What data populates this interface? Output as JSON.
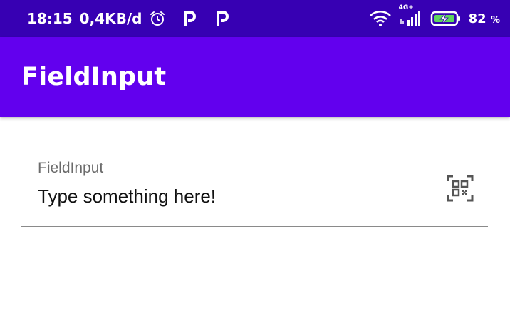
{
  "status_bar": {
    "time": "18:15",
    "network_speed": "0,4KB/d",
    "signal_type": "4G+",
    "battery_percent": "82",
    "battery_unit": "%",
    "icons": [
      "alarm-icon",
      "parking-app-icon",
      "parking-app-icon",
      "wifi-icon",
      "cell-signal-icon",
      "battery-charging-icon"
    ]
  },
  "app_bar": {
    "title": "FieldInput",
    "color": "#6200ee",
    "status_color": "#3700b3"
  },
  "field": {
    "label": "FieldInput",
    "value": "",
    "placeholder": "Type something here!",
    "trailing_icon": "qr-code-scan-icon"
  }
}
